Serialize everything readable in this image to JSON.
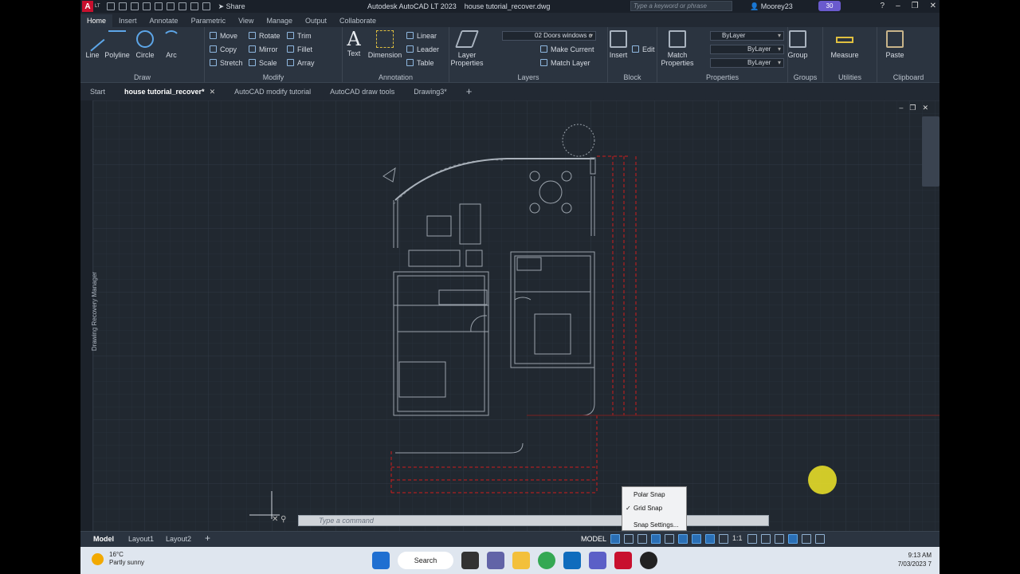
{
  "window": {
    "app_title": "Autodesk AutoCAD LT 2023",
    "file_name": "house tutorial_recover.dwg",
    "logo": "A",
    "edition": "LT",
    "share_label": "Share",
    "search_placeholder": "Type a keyword or phrase",
    "user": "Moorey23",
    "badge": "30"
  },
  "ribbon_tabs": [
    "Home",
    "Insert",
    "Annotate",
    "Parametric",
    "View",
    "Manage",
    "Output",
    "Collaborate"
  ],
  "ribbon": {
    "draw": {
      "title": "Draw",
      "line": "Line",
      "polyline": "Polyline",
      "circle": "Circle",
      "arc": "Arc"
    },
    "modify": {
      "title": "Modify",
      "move": "Move",
      "rotate": "Rotate",
      "trim": "Trim",
      "copy": "Copy",
      "mirror": "Mirror",
      "fillet": "Fillet",
      "stretch": "Stretch",
      "scale": "Scale",
      "array": "Array"
    },
    "annotation": {
      "title": "Annotation",
      "text": "Text",
      "dimension": "Dimension",
      "linear": "Linear",
      "leader": "Leader",
      "table": "Table"
    },
    "layers": {
      "title": "Layers",
      "layer_properties": "Layer Properties",
      "current_layer": "02 Doors windows c",
      "make_current": "Make Current",
      "match_layer": "Match Layer"
    },
    "block": {
      "title": "Block",
      "insert": "Insert",
      "edit": "Edit"
    },
    "properties": {
      "title": "Properties",
      "match_properties": "Match Properties",
      "color": "ByLayer",
      "linetype": "ByLayer",
      "lineweight": "ByLayer"
    },
    "groups": {
      "title": "Groups",
      "group": "Group"
    },
    "utilities": {
      "title": "Utilities",
      "measure": "Measure"
    },
    "clipboard": {
      "title": "Clipboard",
      "paste": "Paste"
    }
  },
  "doc_tabs": [
    {
      "label": "Start"
    },
    {
      "label": "house tutorial_recover*"
    },
    {
      "label": "AutoCAD modify tutorial"
    },
    {
      "label": "AutoCAD draw tools"
    },
    {
      "label": "Drawing3*"
    }
  ],
  "side_palette": "Drawing Recovery Manager",
  "command_line": {
    "placeholder": "Type  a  command"
  },
  "snap_menu": {
    "items": [
      "Polar Snap",
      "Grid Snap",
      "Snap Settings..."
    ],
    "checked": "Grid Snap"
  },
  "status": {
    "layouts": [
      "Model",
      "Layout1",
      "Layout2"
    ],
    "model_label": "MODEL",
    "scale": "1:1"
  },
  "taskbar": {
    "temperature": "16°C",
    "weather": "Partly sunny",
    "search": "Search",
    "time": "9:13 AM",
    "date": "7/03/2023",
    "notifications": "7"
  }
}
